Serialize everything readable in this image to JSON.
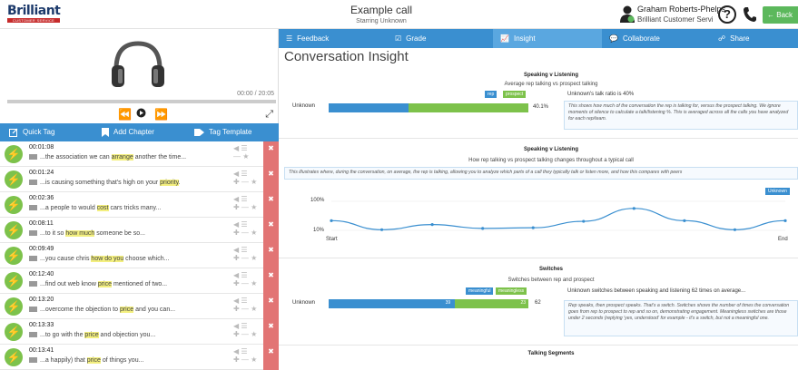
{
  "topbar": {
    "logo": "Brilliant",
    "logo_sub": "CUSTOMER SERVICE",
    "title": "Example call",
    "subtitle": "Starring Unknown",
    "user_name": "Graham Roberts-Phelps",
    "user_role": "Brilliant Customer Servi...",
    "help_label": "?",
    "back_label": "Back"
  },
  "player": {
    "time": "00:00 / 20:05"
  },
  "tagbar": {
    "quick_tag": "Quick Tag",
    "add_chapter": "Add Chapter",
    "tag_template": "Tag Template"
  },
  "tags": [
    {
      "time": "00:01:08",
      "pre": "...the association we can ",
      "hl": "arrange",
      "post": " another the time..."
    },
    {
      "time": "00:01:24",
      "pre": "...is causing something that's high on your ",
      "hl": "priority",
      "post": "."
    },
    {
      "time": "00:02:36",
      "pre": "...a people to would ",
      "hl": "cost",
      "post": " cars tricks many..."
    },
    {
      "time": "00:08:11",
      "pre": "...to it so ",
      "hl": "how much",
      "post": " someone be so..."
    },
    {
      "time": "00:09:49",
      "pre": "...you cause chris ",
      "hl": "how do you",
      "post": " choose which..."
    },
    {
      "time": "00:12:40",
      "pre": "...find out web know ",
      "hl": "price",
      "post": " mentioned of two..."
    },
    {
      "time": "00:13:20",
      "pre": "...overcome the objection to ",
      "hl": "price",
      "post": " and you can..."
    },
    {
      "time": "00:13:33",
      "pre": "...to go with the ",
      "hl": "price",
      "post": " and objection you..."
    },
    {
      "time": "00:13:41",
      "pre": "...a happily) that ",
      "hl": "price",
      "post": " of things you..."
    }
  ],
  "tabs": {
    "feedback": "Feedback",
    "grade": "Grade",
    "insight": "Insight",
    "collaborate": "Collaborate",
    "share": "Share"
  },
  "page_title": "Conversation Insight",
  "speaking": {
    "title": "Speaking v Listening",
    "subtitle": "Average rep talking vs prospect talking",
    "legend_rep": "rep",
    "legend_prospect": "prospect",
    "row_label": "Unknown",
    "pct_label": "40.1%",
    "rep_fraction": 0.401,
    "ratio_text": "Unknown's talk ratio is 40%",
    "note": "This shows how much of the conversation the rep is talking for, versus the prospect talking. We ignore moments of silence to calculate a talk/listening %. This is averaged across all the calls you have analyzed for each rep/team."
  },
  "timeline": {
    "title": "Speaking v Listening",
    "subtitle": "How rep talking vs prospect talking changes throughout a typical call",
    "note": "This illustrates where, during the conversation, on average, the rep is talking, allowing you to analyze which parts of a call they typically talk or listen more, and how this compares with peers",
    "legend": "Unknown",
    "y_top": "100%",
    "y_bottom": "10%",
    "x_start": "Start",
    "x_end": "End",
    "color": "#3a8fd0"
  },
  "chart_data": {
    "type": "line",
    "title": "Speaking v Listening",
    "subtitle": "How rep talking vs prospect talking changes throughout a typical call",
    "x": [
      0,
      1,
      2,
      3,
      4,
      5,
      6,
      7,
      8,
      9
    ],
    "series": [
      {
        "name": "Unknown",
        "values": [
          40,
          12,
          28,
          16,
          18,
          38,
          78,
          40,
          12,
          40
        ]
      }
    ],
    "ylim": [
      10,
      100
    ],
    "x_labels": [
      "Start",
      "End"
    ],
    "y_labels": [
      "100%",
      "10%"
    ]
  },
  "switches": {
    "title": "Switches",
    "subtitle": "Switches between rep and prospect",
    "legend_meaningful": "meaningful",
    "legend_meaningless": "meaningless",
    "row_label": "Unknown",
    "meaningful_value": "39",
    "meaningless_value": "23",
    "total_label": "62",
    "meaningful_fraction": 0.63,
    "summary": "Unknown switches between speaking and listening 62 times on average...",
    "note": "Rep speaks, then prospect speaks. That's a switch. Switches shows the number of times the conversation goes from rep to prospect to rep and so on, demonstrating engagement. Meaningless switches are those under 2 seconds (replying 'yes, understood' for example - it's a switch, but not a meaningful one."
  },
  "segments": {
    "title": "Talking Segments"
  },
  "colors": {
    "accent": "#3a8fd0",
    "green": "#7dc24b",
    "delete": "#e27474",
    "highlight": "#f3ef7f"
  }
}
